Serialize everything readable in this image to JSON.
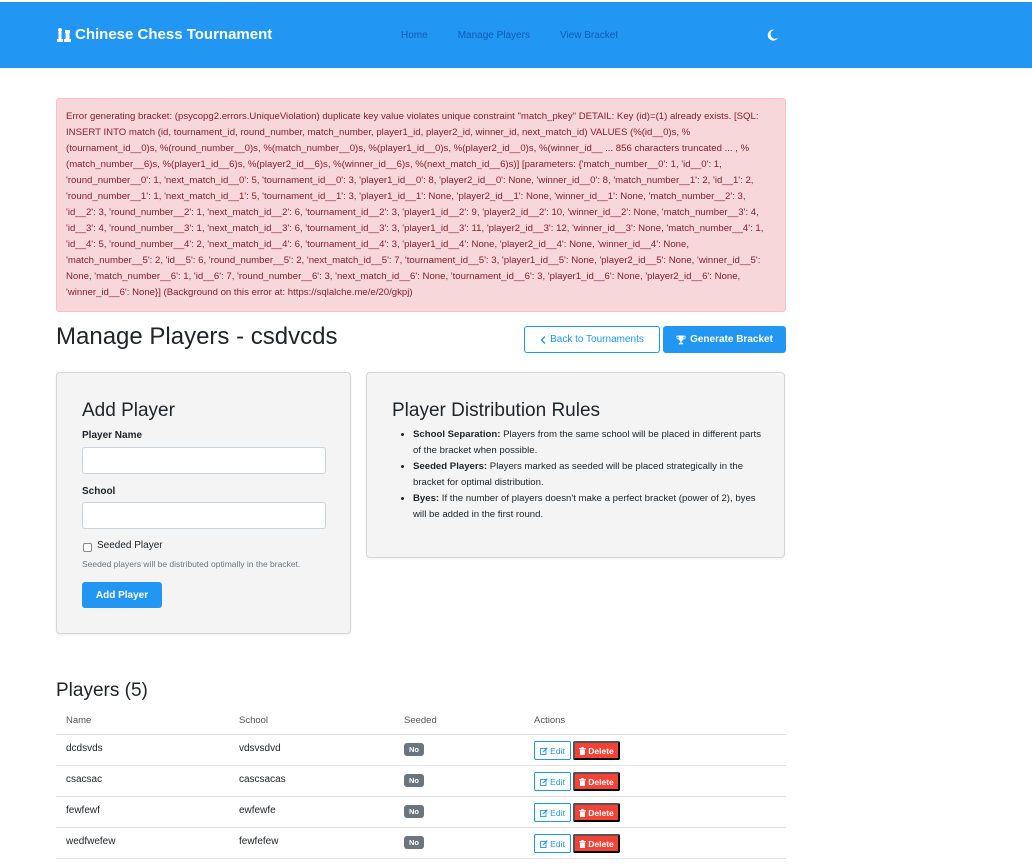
{
  "nav": {
    "brand": "Chinese Chess Tournament",
    "links": [
      "Home",
      "Manage Players",
      "View Bracket"
    ]
  },
  "alert": {
    "text": "Error generating bracket: (psycopg2.errors.UniqueViolation) duplicate key value violates unique constraint \"match_pkey\" DETAIL: Key (id)=(1) already exists. [SQL: INSERT INTO match (id, tournament_id, round_number, match_number, player1_id, player2_id, winner_id, next_match_id) VALUES (%(id__0)s, %(tournament_id__0)s, %(round_number__0)s, %(match_number__0)s, %(player1_id__0)s, %(player2_id__0)s, %(winner_id__ ... 856 characters truncated ... , %(match_number__6)s, %(player1_id__6)s, %(player2_id__6)s, %(winner_id__6)s, %(next_match_id__6)s)] [parameters: {'match_number__0': 1, 'id__0': 1, 'round_number__0': 1, 'next_match_id__0': 5, 'tournament_id__0': 3, 'player1_id__0': 8, 'player2_id__0': None, 'winner_id__0': 8, 'match_number__1': 2, 'id__1': 2, 'round_number__1': 1, 'next_match_id__1': 5, 'tournament_id__1': 3, 'player1_id__1': None, 'player2_id__1': None, 'winner_id__1': None, 'match_number__2': 3, 'id__2': 3, 'round_number__2': 1, 'next_match_id__2': 6, 'tournament_id__2': 3, 'player1_id__2': 9, 'player2_id__2': 10, 'winner_id__2': None, 'match_number__3': 4, 'id__3': 4, 'round_number__3': 1, 'next_match_id__3': 6, 'tournament_id__3': 3, 'player1_id__3': 11, 'player2_id__3': 12, 'winner_id__3': None, 'match_number__4': 1, 'id__4': 5, 'round_number__4': 2, 'next_match_id__4': 6, 'tournament_id__4': 3, 'player1_id__4': None, 'player2_id__4': None, 'winner_id__4': None, 'match_number__5': 2, 'id__5': 6, 'round_number__5': 2, 'next_match_id__5': 7, 'tournament_id__5': 3, 'player1_id__5': None, 'player2_id__5': None, 'winner_id__5': None, 'match_number__6': 1, 'id__6': 7, 'round_number__6': 3, 'next_match_id__6': None, 'tournament_id__6': 3, 'player1_id__6': None, 'player2_id__6': None, 'winner_id__6': None}] (Background on this error at: https://sqlalche.me/e/20/gkpj)"
  },
  "page": {
    "title": "Manage Players - csdvcds",
    "back_label": "Back to Tournaments",
    "generate_label": "Generate Bracket"
  },
  "add_player": {
    "title": "Add Player",
    "name_label": "Player Name",
    "name_value": "",
    "school_label": "School",
    "school_value": "",
    "seeded_label": "Seeded Player",
    "seeded_help": "Seeded players will be distributed optimally in the bracket.",
    "submit_label": "Add Player"
  },
  "rules": {
    "title": "Player Distribution Rules",
    "items": [
      {
        "term": "School Separation:",
        "text": " Players from the same school will be placed in different parts of the bracket when possible."
      },
      {
        "term": "Seeded Players:",
        "text": " Players marked as seeded will be placed strategically in the bracket for optimal distribution."
      },
      {
        "term": "Byes:",
        "text": " If the number of players doesn't make a perfect bracket (power of 2), byes will be added in the first round."
      }
    ]
  },
  "players": {
    "title": "Players (5)",
    "columns": [
      "Name",
      "School",
      "Seeded",
      "Actions"
    ],
    "edit_label": "Edit",
    "delete_label": "Delete",
    "rows": [
      {
        "name": "dcdsvds",
        "school": "vdsvsdvd",
        "seeded": "No"
      },
      {
        "name": "csacsac",
        "school": "cascsacas",
        "seeded": "No"
      },
      {
        "name": "fewfewf",
        "school": "ewfewfe",
        "seeded": "No"
      },
      {
        "name": "wedfwefew",
        "school": "fewfefew",
        "seeded": "No"
      }
    ]
  },
  "colors": {
    "primary": "#2196f3",
    "danger": "#f44336",
    "alert_bg": "#f8d7da",
    "alert_text": "#842029"
  }
}
